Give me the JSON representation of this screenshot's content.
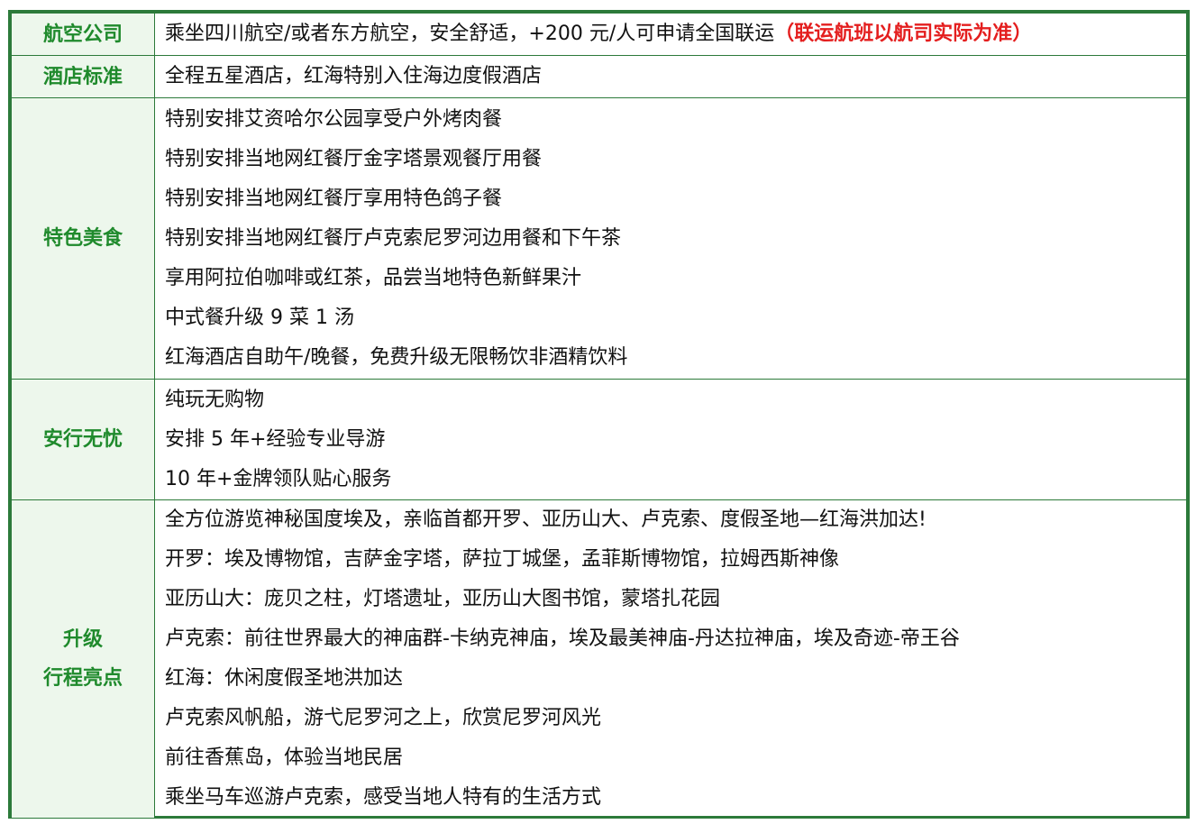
{
  "rows": [
    {
      "label_lines": [
        "航空公司"
      ],
      "lines": [
        "乘坐四川航空/或者东方航空，安全舒适，+200 元/人可申请全国联运"
      ],
      "note": "（联运航班以航司实际为准）"
    },
    {
      "label_lines": [
        "酒店标准"
      ],
      "lines": [
        "全程五星酒店，红海特别入住海边度假酒店"
      ]
    },
    {
      "label_lines": [
        "特色美食"
      ],
      "lines": [
        "特别安排艾资哈尔公园享受户外烤肉餐",
        "特别安排当地网红餐厅金字塔景观餐厅用餐",
        "特别安排当地网红餐厅享用特色鸽子餐",
        "特别安排当地网红餐厅卢克索尼罗河边用餐和下午茶",
        "享用阿拉伯咖啡或红茶，品尝当地特色新鲜果汁",
        "中式餐升级 9 菜 1 汤",
        "红海酒店自助午/晚餐，免费升级无限畅饮非酒精饮料"
      ]
    },
    {
      "label_lines": [
        "安行无忧"
      ],
      "lines": [
        "纯玩无购物",
        "安排 5 年+经验专业导游",
        "10 年+金牌领队贴心服务"
      ]
    },
    {
      "label_lines": [
        "升级",
        "行程亮点"
      ],
      "lines": [
        "全方位游览神秘国度埃及，亲临首都开罗、亚历山大、卢克索、度假圣地—红海洪加达!",
        "开罗：埃及博物馆，吉萨金字塔，萨拉丁城堡，孟菲斯博物馆，拉姆西斯神像",
        "亚历山大：庞贝之柱，灯塔遗址，亚历山大图书馆，蒙塔扎花园",
        "卢克索：前往世界最大的神庙群-卡纳克神庙，埃及最美神庙-丹达拉神庙，埃及奇迹-帝王谷",
        "红海：休闲度假圣地洪加达",
        "卢克索风帆船，游弋尼罗河之上，欣赏尼罗河风光",
        "前往香蕉岛，体验当地民居",
        "乘坐马车巡游卢克索，感受当地人特有的生活方式"
      ]
    }
  ],
  "colors": {
    "border": "#2c7a3a",
    "label_text": "#1f8a2c",
    "label_bg": "#edf7ec",
    "note_text": "#e41e1e",
    "body_text": "#111111"
  }
}
